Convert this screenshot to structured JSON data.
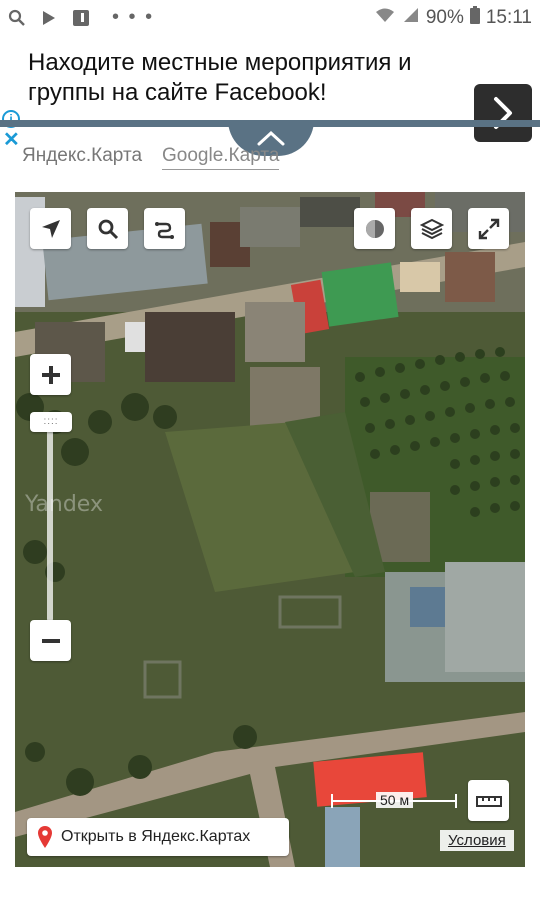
{
  "status_bar": {
    "battery_percent": "90%",
    "time": "15:11",
    "icons": [
      "search-icon",
      "play-store-icon",
      "app-icon",
      "more-icon",
      "wifi-icon",
      "signal-icon",
      "battery-icon"
    ]
  },
  "ad": {
    "text": "Находите местные мероприятия и группы на сайте Facebook!",
    "info_icon": "info-icon",
    "close_icon": "close-icon",
    "arrow_icon": "chevron-right-icon"
  },
  "map_tabs": {
    "yandex": "Яндекс.Карта",
    "google": "Google.Карта"
  },
  "map": {
    "watermark": "Yandex",
    "open_button": "Открыть в Яндекс.Картах",
    "scale_label": "50 м",
    "terms_link": "Условия",
    "zoom_handle": "::::",
    "colors": {
      "roof_red": "#e8473a",
      "roof_green": "#3e9a52",
      "field": "#4e5a36"
    }
  }
}
